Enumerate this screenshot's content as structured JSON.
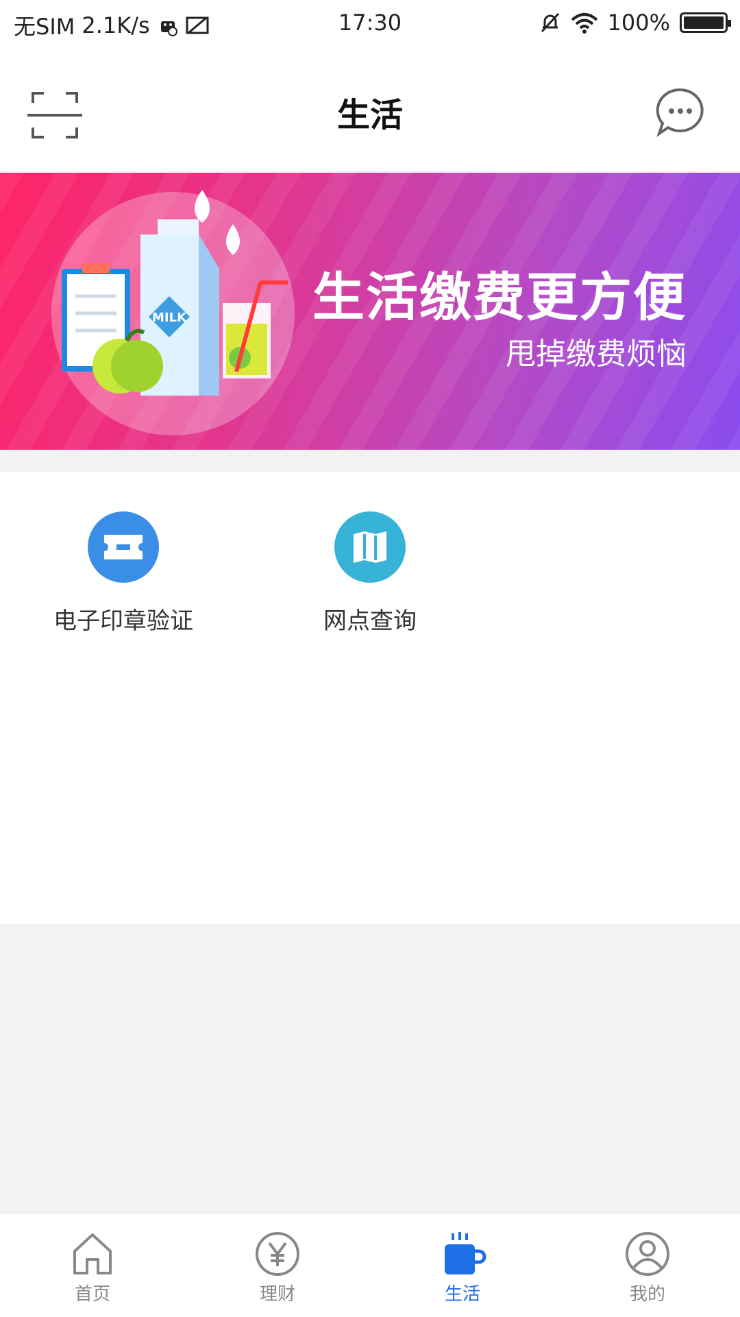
{
  "status_bar": {
    "carrier": "无SIM",
    "speed": "2.1K/s",
    "time": "17:30",
    "battery": "100%"
  },
  "header": {
    "title": "生活"
  },
  "banner": {
    "headline": "生活缴费更方便",
    "subline": "甩掉缴费烦恼",
    "badge": "MILK"
  },
  "services": [
    {
      "label": "电子印章验证",
      "icon": "ticket-icon",
      "color": "#3a8ee6"
    },
    {
      "label": "网点查询",
      "icon": "map-icon",
      "color": "#36b3d6"
    }
  ],
  "tabs": [
    {
      "label": "首页",
      "icon": "home-icon",
      "active": false
    },
    {
      "label": "理财",
      "icon": "yen-icon",
      "active": false
    },
    {
      "label": "生活",
      "icon": "cup-icon",
      "active": true
    },
    {
      "label": "我的",
      "icon": "user-icon",
      "active": false
    }
  ],
  "colors": {
    "accent": "#1e6fe5",
    "banner_start": "#ff2466",
    "banner_end": "#8b4cf0"
  }
}
